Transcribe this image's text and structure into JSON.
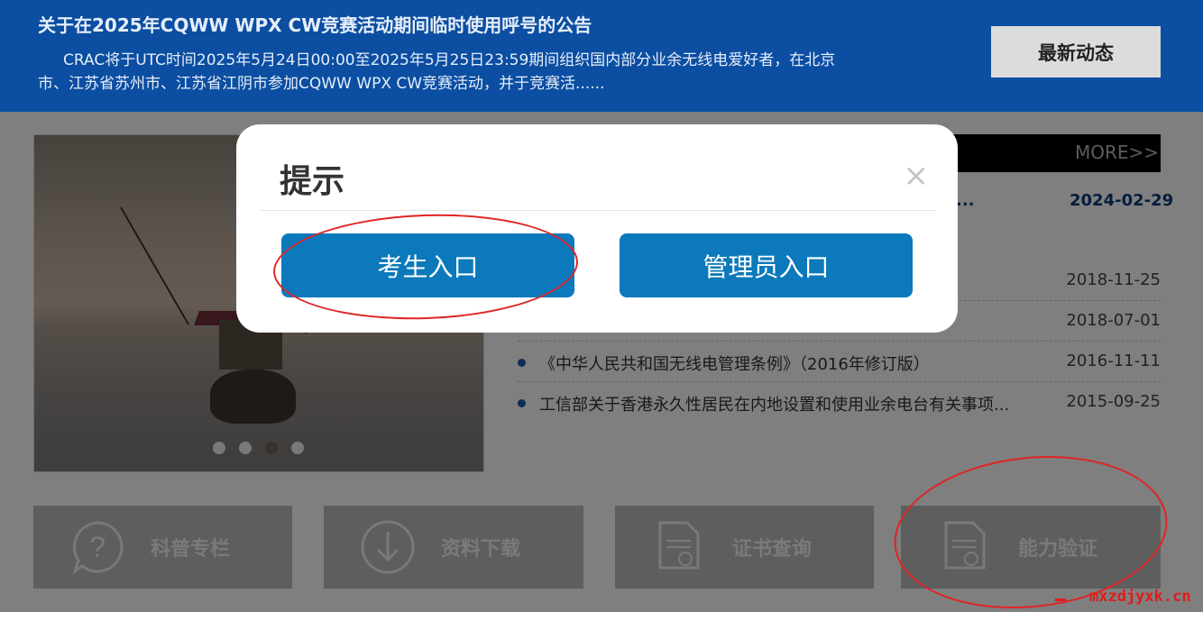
{
  "banner": {
    "title": "关于在2025年CQWW WPX CW竞赛活动期间临时使用呼号的公告",
    "description": "CRAC将于UTC时间2025年5月24日00:00至2025年5月25日23:59期间组织国内部分业余无线电爱好者，在北京市、江苏省苏州市、江苏省江阴市参加CQWW WPX CW竞赛活动，并于竞赛活......",
    "latest_button": "最新动态"
  },
  "carousel": {
    "dots": 4,
    "active_dot_index": 2
  },
  "news": {
    "more_label": "MORE>>",
    "first": {
      "title_tail": "...",
      "date": "2024-02-29"
    },
    "items": [
      {
        "title": "",
        "date": "2018-11-25"
      },
      {
        "title": "",
        "date": "2018-07-01"
      },
      {
        "title": "《中华人民共和国无线电管理条例》（2016年修订版）",
        "date": "2016-11-11"
      },
      {
        "title": "工信部关于香港永久性居民在内地设置和使用业余电台有关事项...",
        "date": "2015-09-25"
      }
    ]
  },
  "tiles": [
    {
      "label": "科普专栏",
      "icon": "question-bubble-icon"
    },
    {
      "label": "资料下载",
      "icon": "download-arrow-icon"
    },
    {
      "label": "证书查询",
      "icon": "certificate-icon"
    },
    {
      "label": "能力验证",
      "icon": "certificate-icon"
    }
  ],
  "modal": {
    "title": "提示",
    "close_symbol": "×",
    "candidate_button": "考生入口",
    "admin_button": "管理员入口"
  },
  "watermark": "mxzdjyxk.cn",
  "colors": {
    "banner": "#0b4ea2",
    "primary_button": "#0b79bb",
    "annotation": "#e02424",
    "watermark": "#e21b1b"
  }
}
